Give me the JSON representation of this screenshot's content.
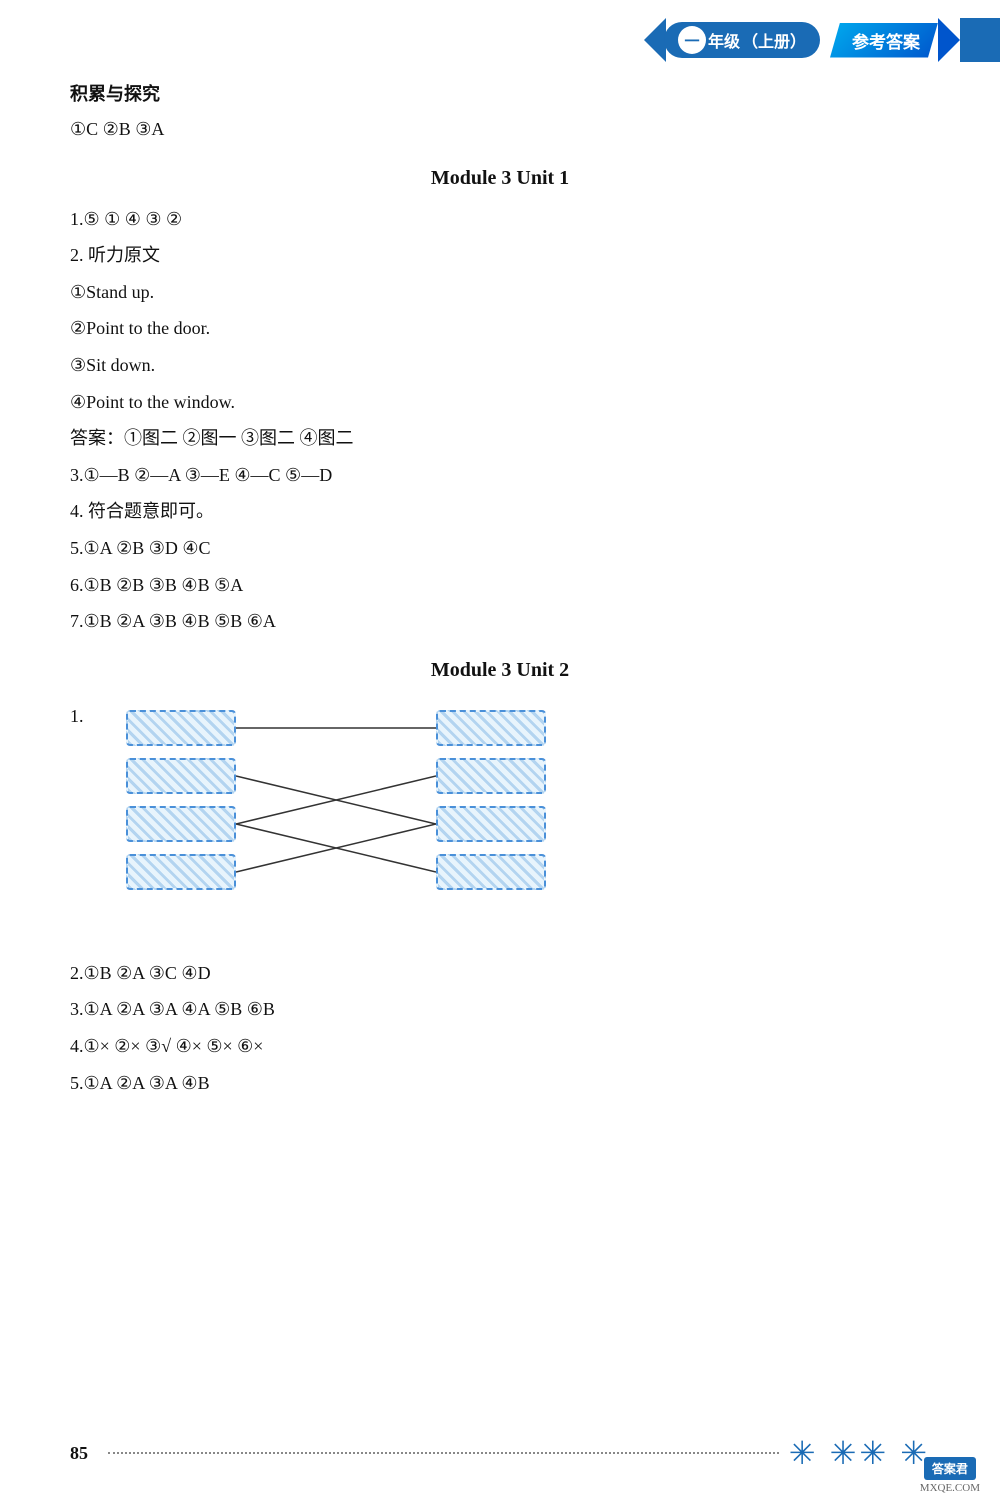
{
  "header": {
    "grade_text": "年级",
    "level_text": "（上册）",
    "ref_text": "参考答案",
    "grade_num": "一"
  },
  "sections": {
    "jljty": {
      "title": "积累与探究",
      "answers": "①C  ②B  ③A"
    },
    "module3unit1": {
      "heading": "Module 3    Unit 1",
      "q1": "1.⑤  ①  ④  ③  ②",
      "q2_title": "2. 听力原文",
      "q2_items": [
        "①Stand up.",
        "②Point to the door.",
        "③Sit down.",
        "④Point to the window."
      ],
      "q2_ans": "答案：①图二  ②图一  ③图二  ④图二",
      "q3": "3.①—B  ②—A  ③—E  ④—C  ⑤—D",
      "q4": "4. 符合题意即可。",
      "q5": "5.①A  ②B  ③D  ④C",
      "q6": "6.①B  ②B  ③B  ④B  ⑤A",
      "q7": "7.①B  ②A  ③B  ④B  ⑤B  ⑥A"
    },
    "module3unit2": {
      "heading": "Module 3    Unit 2",
      "q1_label": "1.",
      "q2": "2.①B  ②A  ③C  ④D",
      "q3": "3.①A  ②A  ③A  ④A  ⑤B  ⑥B",
      "q4": "4.①×  ②×  ③√  ④×  ⑤×  ⑥×",
      "q5": "5.①A  ②A  ③A  ④B"
    }
  },
  "footer": {
    "page_num": "85",
    "watermark": "答案君",
    "logo_text": "答案君",
    "logo_url": "MXQE.COM"
  }
}
